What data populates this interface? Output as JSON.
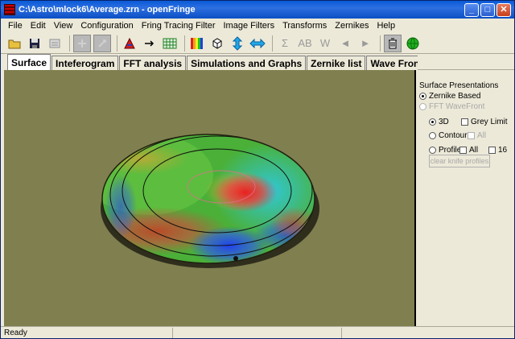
{
  "window": {
    "title": "C:\\Astro\\mlock6\\Average.zrn - openFringe",
    "minimize_label": "_",
    "maximize_label": "□",
    "close_label": "✕"
  },
  "menu": {
    "items": [
      "File",
      "Edit",
      "View",
      "Configuration",
      "Fring Tracing Filter",
      "Image Filters",
      "Transforms",
      "Zernikes",
      "Help"
    ]
  },
  "toolbar": {
    "sum_label": "Σ",
    "ab_label": "AB",
    "w_label": "W",
    "prev_label": "◄",
    "next_label": "►"
  },
  "tabs": [
    "Surface",
    "Inteferogram",
    "FFT analysis",
    "Simulations and Graphs",
    "Zernike list",
    "Wave Front list"
  ],
  "panel": {
    "heading": "Surface Presentations",
    "zernike_based": "Zernike Based",
    "fft_wavefront": "FFT WaveFront",
    "opt_3d": "3D",
    "grey_limit": "Grey Limit",
    "contour": "Contour",
    "all": "All",
    "profile": "Profile",
    "profile_all": "All",
    "sixteen": "16",
    "clear_btn": "clear knife profiles"
  },
  "status": {
    "text": "Ready"
  },
  "colors": {
    "viewport_bg": "#807f4f",
    "titlebar": "#0a5ad8"
  }
}
